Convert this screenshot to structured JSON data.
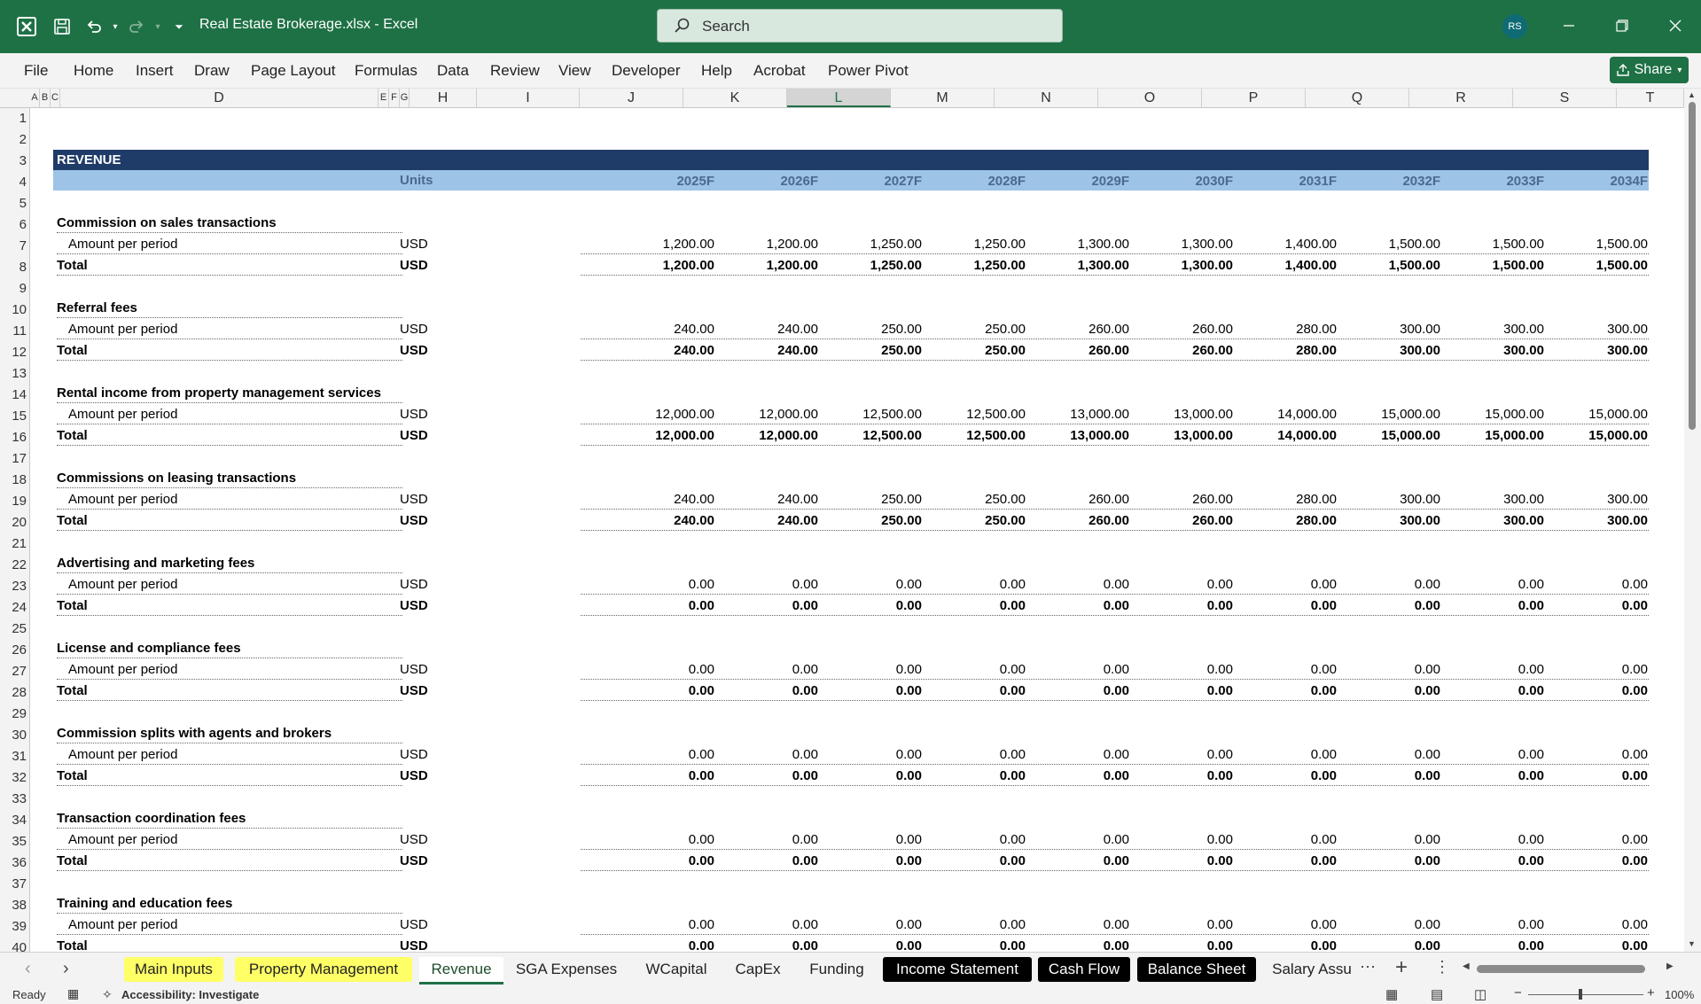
{
  "app": {
    "document_title": "Real Estate Brokerage.xlsx  -  Excel",
    "search_placeholder": "Search",
    "user_initials": "RS",
    "share_label": "Share"
  },
  "ribbon_tabs": [
    "File",
    "Home",
    "Insert",
    "Draw",
    "Page Layout",
    "Formulas",
    "Data",
    "Review",
    "View",
    "Developer",
    "Help",
    "Acrobat",
    "Power Pivot"
  ],
  "columns": [
    "A",
    "B",
    "C",
    "D",
    "E",
    "F",
    "G",
    "H",
    "I",
    "J",
    "K",
    "L",
    "M",
    "N",
    "O",
    "P",
    "Q",
    "R",
    "S",
    "T"
  ],
  "selected_column": "L",
  "rows": [
    "1",
    "2",
    "3",
    "4",
    "5",
    "6",
    "7",
    "8",
    "9",
    "10",
    "11",
    "12",
    "13",
    "14",
    "15",
    "16",
    "17",
    "18",
    "19",
    "20",
    "21",
    "22",
    "23",
    "24",
    "25",
    "26",
    "27",
    "28",
    "29",
    "30",
    "31",
    "32",
    "33",
    "34",
    "35",
    "36",
    "37",
    "38",
    "39",
    "40"
  ],
  "sheet": {
    "section_title": "REVENUE",
    "units_header": "Units",
    "years": [
      "2025F",
      "2026F",
      "2027F",
      "2028F",
      "2029F",
      "2030F",
      "2031F",
      "2032F",
      "2033F",
      "2034F"
    ],
    "line_label": "Amount per period",
    "total_label": "Total",
    "unit": "USD",
    "blocks": [
      {
        "title": "Commission on sales transactions",
        "amounts": [
          "1,200.00",
          "1,200.00",
          "1,250.00",
          "1,250.00",
          "1,300.00",
          "1,300.00",
          "1,400.00",
          "1,500.00",
          "1,500.00",
          "1,500.00"
        ],
        "totals": [
          "1,200.00",
          "1,200.00",
          "1,250.00",
          "1,250.00",
          "1,300.00",
          "1,300.00",
          "1,400.00",
          "1,500.00",
          "1,500.00",
          "1,500.00"
        ]
      },
      {
        "title": "Referral fees",
        "amounts": [
          "240.00",
          "240.00",
          "250.00",
          "250.00",
          "260.00",
          "260.00",
          "280.00",
          "300.00",
          "300.00",
          "300.00"
        ],
        "totals": [
          "240.00",
          "240.00",
          "250.00",
          "250.00",
          "260.00",
          "260.00",
          "280.00",
          "300.00",
          "300.00",
          "300.00"
        ]
      },
      {
        "title": "Rental income from property management services",
        "amounts": [
          "12,000.00",
          "12,000.00",
          "12,500.00",
          "12,500.00",
          "13,000.00",
          "13,000.00",
          "14,000.00",
          "15,000.00",
          "15,000.00",
          "15,000.00"
        ],
        "totals": [
          "12,000.00",
          "12,000.00",
          "12,500.00",
          "12,500.00",
          "13,000.00",
          "13,000.00",
          "14,000.00",
          "15,000.00",
          "15,000.00",
          "15,000.00"
        ]
      },
      {
        "title": "Commissions on leasing transactions",
        "amounts": [
          "240.00",
          "240.00",
          "250.00",
          "250.00",
          "260.00",
          "260.00",
          "280.00",
          "300.00",
          "300.00",
          "300.00"
        ],
        "totals": [
          "240.00",
          "240.00",
          "250.00",
          "250.00",
          "260.00",
          "260.00",
          "280.00",
          "300.00",
          "300.00",
          "300.00"
        ]
      },
      {
        "title": "Advertising and marketing fees",
        "amounts": [
          "0.00",
          "0.00",
          "0.00",
          "0.00",
          "0.00",
          "0.00",
          "0.00",
          "0.00",
          "0.00",
          "0.00"
        ],
        "totals": [
          "0.00",
          "0.00",
          "0.00",
          "0.00",
          "0.00",
          "0.00",
          "0.00",
          "0.00",
          "0.00",
          "0.00"
        ]
      },
      {
        "title": "License and compliance fees",
        "amounts": [
          "0.00",
          "0.00",
          "0.00",
          "0.00",
          "0.00",
          "0.00",
          "0.00",
          "0.00",
          "0.00",
          "0.00"
        ],
        "totals": [
          "0.00",
          "0.00",
          "0.00",
          "0.00",
          "0.00",
          "0.00",
          "0.00",
          "0.00",
          "0.00",
          "0.00"
        ]
      },
      {
        "title": "Commission splits with agents and brokers",
        "amounts": [
          "0.00",
          "0.00",
          "0.00",
          "0.00",
          "0.00",
          "0.00",
          "0.00",
          "0.00",
          "0.00",
          "0.00"
        ],
        "totals": [
          "0.00",
          "0.00",
          "0.00",
          "0.00",
          "0.00",
          "0.00",
          "0.00",
          "0.00",
          "0.00",
          "0.00"
        ]
      },
      {
        "title": "Transaction coordination fees",
        "amounts": [
          "0.00",
          "0.00",
          "0.00",
          "0.00",
          "0.00",
          "0.00",
          "0.00",
          "0.00",
          "0.00",
          "0.00"
        ],
        "totals": [
          "0.00",
          "0.00",
          "0.00",
          "0.00",
          "0.00",
          "0.00",
          "0.00",
          "0.00",
          "0.00",
          "0.00"
        ]
      },
      {
        "title": "Training and education fees",
        "amounts": [
          "0.00",
          "0.00",
          "0.00",
          "0.00",
          "0.00",
          "0.00",
          "0.00",
          "0.00",
          "0.00",
          "0.00"
        ],
        "totals": [
          "0.00",
          "0.00",
          "0.00",
          "0.00",
          "0.00",
          "0.00",
          "0.00",
          "0.00",
          "0.00",
          "0.00"
        ]
      }
    ]
  },
  "sheet_tabs": [
    {
      "label": "Main Inputs",
      "style": "yellow"
    },
    {
      "label": "Property Management",
      "style": "yellow"
    },
    {
      "label": "Revenue",
      "style": "active"
    },
    {
      "label": "SGA Expenses",
      "style": "plain"
    },
    {
      "label": "WCapital",
      "style": "plain"
    },
    {
      "label": "CapEx",
      "style": "plain"
    },
    {
      "label": "Funding",
      "style": "plain"
    },
    {
      "label": "Income Statement",
      "style": "black"
    },
    {
      "label": "Cash Flow",
      "style": "black"
    },
    {
      "label": "Balance Sheet",
      "style": "black"
    },
    {
      "label": "Salary Assu",
      "style": "plain"
    }
  ],
  "status": {
    "ready": "Ready",
    "accessibility": "Accessibility: Investigate",
    "zoom": "100%"
  },
  "colors": {
    "excel_green": "#1e7145",
    "section_header": "#1f3b68",
    "units_header_bg": "#9dc3e6",
    "units_header_text": "#4a6a8f",
    "tab_yellow": "#ffff66"
  }
}
